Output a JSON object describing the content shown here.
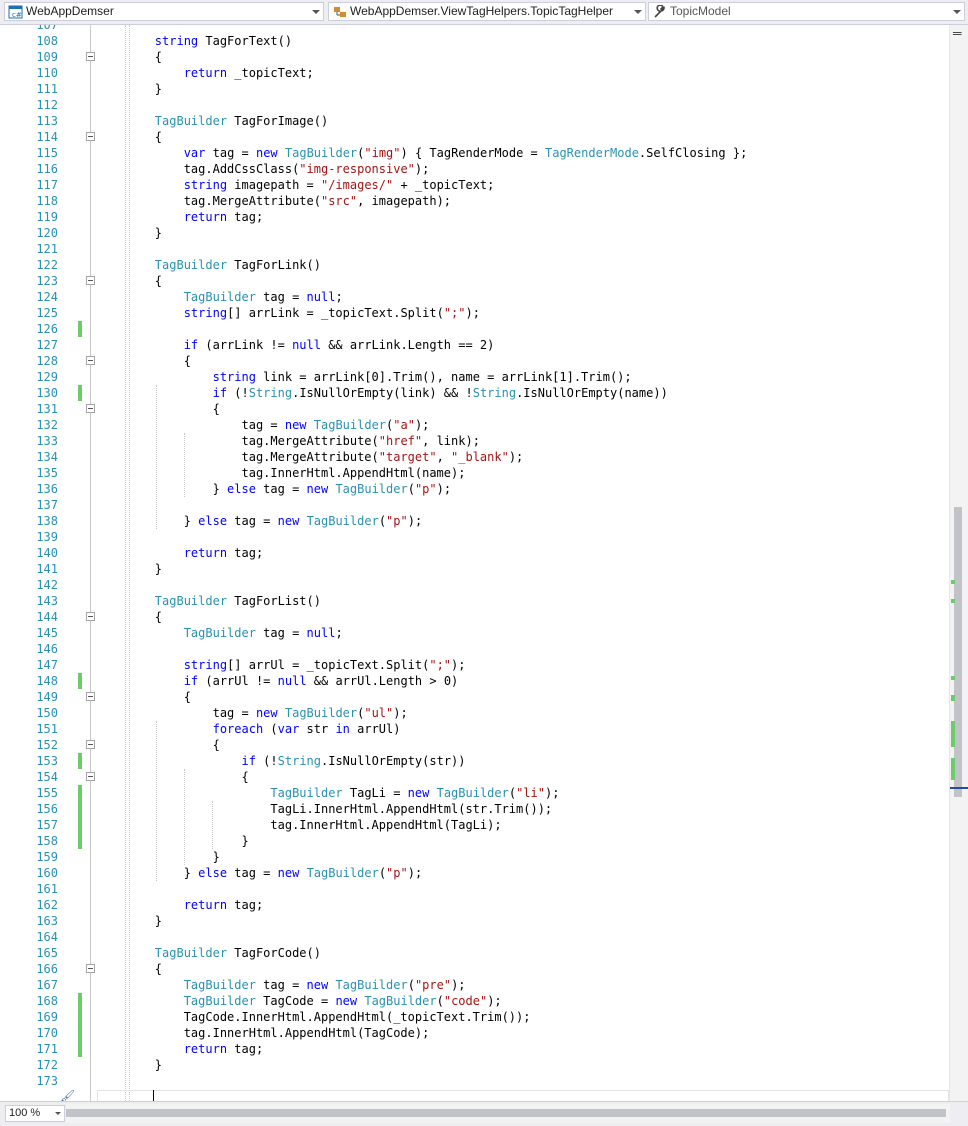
{
  "navbar": {
    "project": "WebAppDemser",
    "type": "WebAppDemser.ViewTagHelpers.TopicTagHelper",
    "member": "TopicModel",
    "project_icon": "csharp-project-icon",
    "type_icon": "class-icon",
    "member_icon": "wrench-icon"
  },
  "colors": {
    "keyword": "#0000ff",
    "type": "#2b91af",
    "string": "#a31515",
    "line_number": "#2b91af",
    "change_bar": "#6ccc6c"
  },
  "editor": {
    "first_line": 108,
    "lines": [
      [
        {
          "t": "        "
        },
        {
          "k": "kw",
          "t": "string"
        },
        {
          "t": " TagForText()"
        }
      ],
      [
        {
          "t": "        {"
        }
      ],
      [
        {
          "t": "            "
        },
        {
          "k": "kw",
          "t": "return"
        },
        {
          "t": " _topicText;"
        }
      ],
      [
        {
          "t": "        }"
        }
      ],
      [],
      [
        {
          "t": "        "
        },
        {
          "k": "ty",
          "t": "TagBuilder"
        },
        {
          "t": " TagForImage()"
        }
      ],
      [
        {
          "t": "        {"
        }
      ],
      [
        {
          "t": "            "
        },
        {
          "k": "kw",
          "t": "var"
        },
        {
          "t": " tag = "
        },
        {
          "k": "kw",
          "t": "new"
        },
        {
          "t": " "
        },
        {
          "k": "ty",
          "t": "TagBuilder"
        },
        {
          "t": "("
        },
        {
          "k": "str",
          "t": "\"img\""
        },
        {
          "t": ") { TagRenderMode = "
        },
        {
          "k": "ty",
          "t": "TagRenderMode"
        },
        {
          "t": ".SelfClosing };"
        }
      ],
      [
        {
          "t": "            tag.AddCssClass("
        },
        {
          "k": "str",
          "t": "\"img-responsive\""
        },
        {
          "t": ");"
        }
      ],
      [
        {
          "t": "            "
        },
        {
          "k": "kw",
          "t": "string"
        },
        {
          "t": " imagepath = "
        },
        {
          "k": "str",
          "t": "\"/images/\""
        },
        {
          "t": " + _topicText;"
        }
      ],
      [
        {
          "t": "            tag.MergeAttribute("
        },
        {
          "k": "str",
          "t": "\"src\""
        },
        {
          "t": ", imagepath);"
        }
      ],
      [
        {
          "t": "            "
        },
        {
          "k": "kw",
          "t": "return"
        },
        {
          "t": " tag;"
        }
      ],
      [
        {
          "t": "        }"
        }
      ],
      [],
      [
        {
          "t": "        "
        },
        {
          "k": "ty",
          "t": "TagBuilder"
        },
        {
          "t": " TagForLink()"
        }
      ],
      [
        {
          "t": "        {"
        }
      ],
      [
        {
          "t": "            "
        },
        {
          "k": "ty",
          "t": "TagBuilder"
        },
        {
          "t": " tag = "
        },
        {
          "k": "kw",
          "t": "null"
        },
        {
          "t": ";"
        }
      ],
      [
        {
          "t": "            "
        },
        {
          "k": "kw",
          "t": "string"
        },
        {
          "t": "[] arrLink = _topicText.Split("
        },
        {
          "k": "str",
          "t": "\";\""
        },
        {
          "t": ");"
        }
      ],
      [],
      [
        {
          "t": "            "
        },
        {
          "k": "kw",
          "t": "if"
        },
        {
          "t": " (arrLink != "
        },
        {
          "k": "kw",
          "t": "null"
        },
        {
          "t": " && arrLink.Length == 2)"
        }
      ],
      [
        {
          "t": "            {"
        }
      ],
      [
        {
          "t": "                "
        },
        {
          "k": "kw",
          "t": "string"
        },
        {
          "t": " link = arrLink[0].Trim(), name = arrLink[1].Trim();"
        }
      ],
      [
        {
          "t": "                "
        },
        {
          "k": "kw",
          "t": "if"
        },
        {
          "t": " (!"
        },
        {
          "k": "ty",
          "t": "String"
        },
        {
          "t": ".IsNullOrEmpty(link) && !"
        },
        {
          "k": "ty",
          "t": "String"
        },
        {
          "t": ".IsNullOrEmpty(name))"
        }
      ],
      [
        {
          "t": "                {"
        }
      ],
      [
        {
          "t": "                    tag = "
        },
        {
          "k": "kw",
          "t": "new"
        },
        {
          "t": " "
        },
        {
          "k": "ty",
          "t": "TagBuilder"
        },
        {
          "t": "("
        },
        {
          "k": "str",
          "t": "\"a\""
        },
        {
          "t": ");"
        }
      ],
      [
        {
          "t": "                    tag.MergeAttribute("
        },
        {
          "k": "str",
          "t": "\"href\""
        },
        {
          "t": ", link);"
        }
      ],
      [
        {
          "t": "                    tag.MergeAttribute("
        },
        {
          "k": "str",
          "t": "\"target\""
        },
        {
          "t": ", "
        },
        {
          "k": "str",
          "t": "\"_blank\""
        },
        {
          "t": ");"
        }
      ],
      [
        {
          "t": "                    tag.InnerHtml.AppendHtml(name);"
        }
      ],
      [
        {
          "t": "                } "
        },
        {
          "k": "kw",
          "t": "else"
        },
        {
          "t": " tag = "
        },
        {
          "k": "kw",
          "t": "new"
        },
        {
          "t": " "
        },
        {
          "k": "ty",
          "t": "TagBuilder"
        },
        {
          "t": "("
        },
        {
          "k": "str",
          "t": "\"p\""
        },
        {
          "t": ");"
        }
      ],
      [],
      [
        {
          "t": "            } "
        },
        {
          "k": "kw",
          "t": "else"
        },
        {
          "t": " tag = "
        },
        {
          "k": "kw",
          "t": "new"
        },
        {
          "t": " "
        },
        {
          "k": "ty",
          "t": "TagBuilder"
        },
        {
          "t": "("
        },
        {
          "k": "str",
          "t": "\"p\""
        },
        {
          "t": ");"
        }
      ],
      [],
      [
        {
          "t": "            "
        },
        {
          "k": "kw",
          "t": "return"
        },
        {
          "t": " tag;"
        }
      ],
      [
        {
          "t": "        }"
        }
      ],
      [],
      [
        {
          "t": "        "
        },
        {
          "k": "ty",
          "t": "TagBuilder"
        },
        {
          "t": " TagForList()"
        }
      ],
      [
        {
          "t": "        {"
        }
      ],
      [
        {
          "t": "            "
        },
        {
          "k": "ty",
          "t": "TagBuilder"
        },
        {
          "t": " tag = "
        },
        {
          "k": "kw",
          "t": "null"
        },
        {
          "t": ";"
        }
      ],
      [],
      [
        {
          "t": "            "
        },
        {
          "k": "kw",
          "t": "string"
        },
        {
          "t": "[] arrUl = _topicText.Split("
        },
        {
          "k": "str",
          "t": "\";\""
        },
        {
          "t": ");"
        }
      ],
      [
        {
          "t": "            "
        },
        {
          "k": "kw",
          "t": "if"
        },
        {
          "t": " (arrUl != "
        },
        {
          "k": "kw",
          "t": "null"
        },
        {
          "t": " && arrUl.Length > 0)"
        }
      ],
      [
        {
          "t": "            {"
        }
      ],
      [
        {
          "t": "                tag = "
        },
        {
          "k": "kw",
          "t": "new"
        },
        {
          "t": " "
        },
        {
          "k": "ty",
          "t": "TagBuilder"
        },
        {
          "t": "("
        },
        {
          "k": "str",
          "t": "\"ul\""
        },
        {
          "t": ");"
        }
      ],
      [
        {
          "t": "                "
        },
        {
          "k": "kw",
          "t": "foreach"
        },
        {
          "t": " ("
        },
        {
          "k": "kw",
          "t": "var"
        },
        {
          "t": " str "
        },
        {
          "k": "kw",
          "t": "in"
        },
        {
          "t": " arrUl)"
        }
      ],
      [
        {
          "t": "                {"
        }
      ],
      [
        {
          "t": "                    "
        },
        {
          "k": "kw",
          "t": "if"
        },
        {
          "t": " (!"
        },
        {
          "k": "ty",
          "t": "String"
        },
        {
          "t": ".IsNullOrEmpty(str))"
        }
      ],
      [
        {
          "t": "                    {"
        }
      ],
      [
        {
          "t": "                        "
        },
        {
          "k": "ty",
          "t": "TagBuilder"
        },
        {
          "t": " TagLi = "
        },
        {
          "k": "kw",
          "t": "new"
        },
        {
          "t": " "
        },
        {
          "k": "ty",
          "t": "TagBuilder"
        },
        {
          "t": "("
        },
        {
          "k": "str",
          "t": "\"li\""
        },
        {
          "t": ");"
        }
      ],
      [
        {
          "t": "                        TagLi.InnerHtml.AppendHtml(str.Trim());"
        }
      ],
      [
        {
          "t": "                        tag.InnerHtml.AppendHtml(TagLi);"
        }
      ],
      [
        {
          "t": "                    }"
        }
      ],
      [
        {
          "t": "                }"
        }
      ],
      [
        {
          "t": "            } "
        },
        {
          "k": "kw",
          "t": "else"
        },
        {
          "t": " tag = "
        },
        {
          "k": "kw",
          "t": "new"
        },
        {
          "t": " "
        },
        {
          "k": "ty",
          "t": "TagBuilder"
        },
        {
          "t": "("
        },
        {
          "k": "str",
          "t": "\"p\""
        },
        {
          "t": ");"
        }
      ],
      [],
      [
        {
          "t": "            "
        },
        {
          "k": "kw",
          "t": "return"
        },
        {
          "t": " tag;"
        }
      ],
      [
        {
          "t": "        }"
        }
      ],
      [],
      [
        {
          "t": "        "
        },
        {
          "k": "ty",
          "t": "TagBuilder"
        },
        {
          "t": " TagForCode()"
        }
      ],
      [
        {
          "t": "        {"
        }
      ],
      [
        {
          "t": "            "
        },
        {
          "k": "ty",
          "t": "TagBuilder"
        },
        {
          "t": " tag = "
        },
        {
          "k": "kw",
          "t": "new"
        },
        {
          "t": " "
        },
        {
          "k": "ty",
          "t": "TagBuilder"
        },
        {
          "t": "("
        },
        {
          "k": "str",
          "t": "\"pre\""
        },
        {
          "t": ");"
        }
      ],
      [
        {
          "t": "            "
        },
        {
          "k": "ty",
          "t": "TagBuilder"
        },
        {
          "t": " TagCode = "
        },
        {
          "k": "kw",
          "t": "new"
        },
        {
          "t": " "
        },
        {
          "k": "ty",
          "t": "TagBuilder"
        },
        {
          "t": "("
        },
        {
          "k": "str",
          "t": "\"code\""
        },
        {
          "t": ");"
        }
      ],
      [
        {
          "t": "            TagCode.InnerHtml.AppendHtml(_topicText.Trim());"
        }
      ],
      [
        {
          "t": "            tag.InnerHtml.AppendHtml(TagCode);"
        }
      ],
      [
        {
          "t": "            "
        },
        {
          "k": "kw",
          "t": "return"
        },
        {
          "t": " tag;"
        }
      ],
      [
        {
          "t": "        }"
        }
      ],
      []
    ],
    "changed_lines": [
      126,
      130,
      148,
      153,
      155,
      156,
      157,
      158,
      168,
      169,
      170,
      171
    ],
    "fold_lines": [
      109,
      114,
      123,
      128,
      131,
      144,
      149,
      152,
      154,
      166
    ],
    "current_line": 174
  },
  "zoom": {
    "value": "100 %"
  },
  "scrollbar": {
    "split_icon": "splitter-icon"
  }
}
